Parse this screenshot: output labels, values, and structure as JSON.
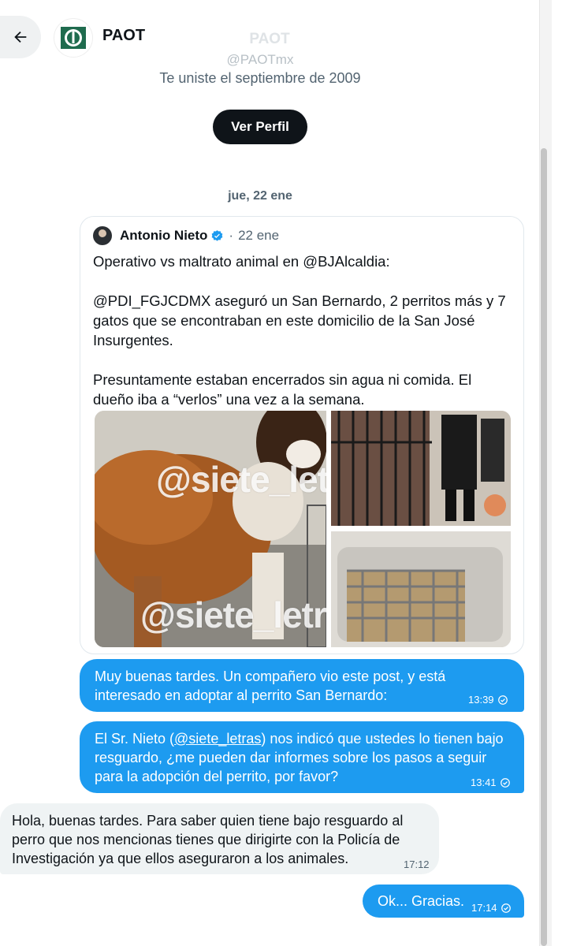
{
  "header": {
    "title": "PAOT",
    "back_icon": "arrow-left-icon",
    "logo_icon": "paot-logo-icon"
  },
  "profile": {
    "name": "PAOT",
    "handle": "@PAOTmx",
    "joined": "Te uniste el septiembre de 2009",
    "view_button": "Ver Perfil"
  },
  "date_separator": "jue, 22 ene",
  "quoted_tweet": {
    "author": "Antonio Nieto",
    "separator": "·",
    "date": "22 ene",
    "paragraphs": [
      "Operativo vs maltrato animal en @BJAlcaldia:",
      "@PDI_FGJCDMX aseguró un San Bernardo, 2 perritos más y 7 gatos que se encontraban en este domicilio de la San José Insurgentes.",
      "Presuntamente estaban encerrados sin agua ni comida. El dueño iba a “verlos” una vez a la semana."
    ],
    "watermark": "@siete_letras"
  },
  "messages": [
    {
      "direction": "out",
      "text": "Muy buenas tardes. Un compañero vio este post, y está interesado en adoptar al perrito San Bernardo:",
      "time": "13:39"
    },
    {
      "direction": "out",
      "text_before": "El Sr. Nieto (",
      "mention": "@siete_letras",
      "text_after": ") nos indicó que ustedes lo tienen bajo resguardo, ¿me pueden dar informes sobre los pasos a seguir para la adopción del perrito, por favor?",
      "time": "13:41"
    },
    {
      "direction": "in",
      "text": "Hola, buenas tardes. Para saber quien tiene bajo resguardo al perro que nos mencionas tienes que dirigirte con la Policía de Investigación ya que ellos aseguraron a los animales.",
      "time": "17:12"
    },
    {
      "direction": "out",
      "text": "Ok... Gracias.",
      "time": "17:14"
    }
  ],
  "colors": {
    "accent": "#1d9bf0",
    "incoming_bubble": "#eff3f4",
    "dark_button": "#0f1419",
    "muted_text": "#536471"
  }
}
